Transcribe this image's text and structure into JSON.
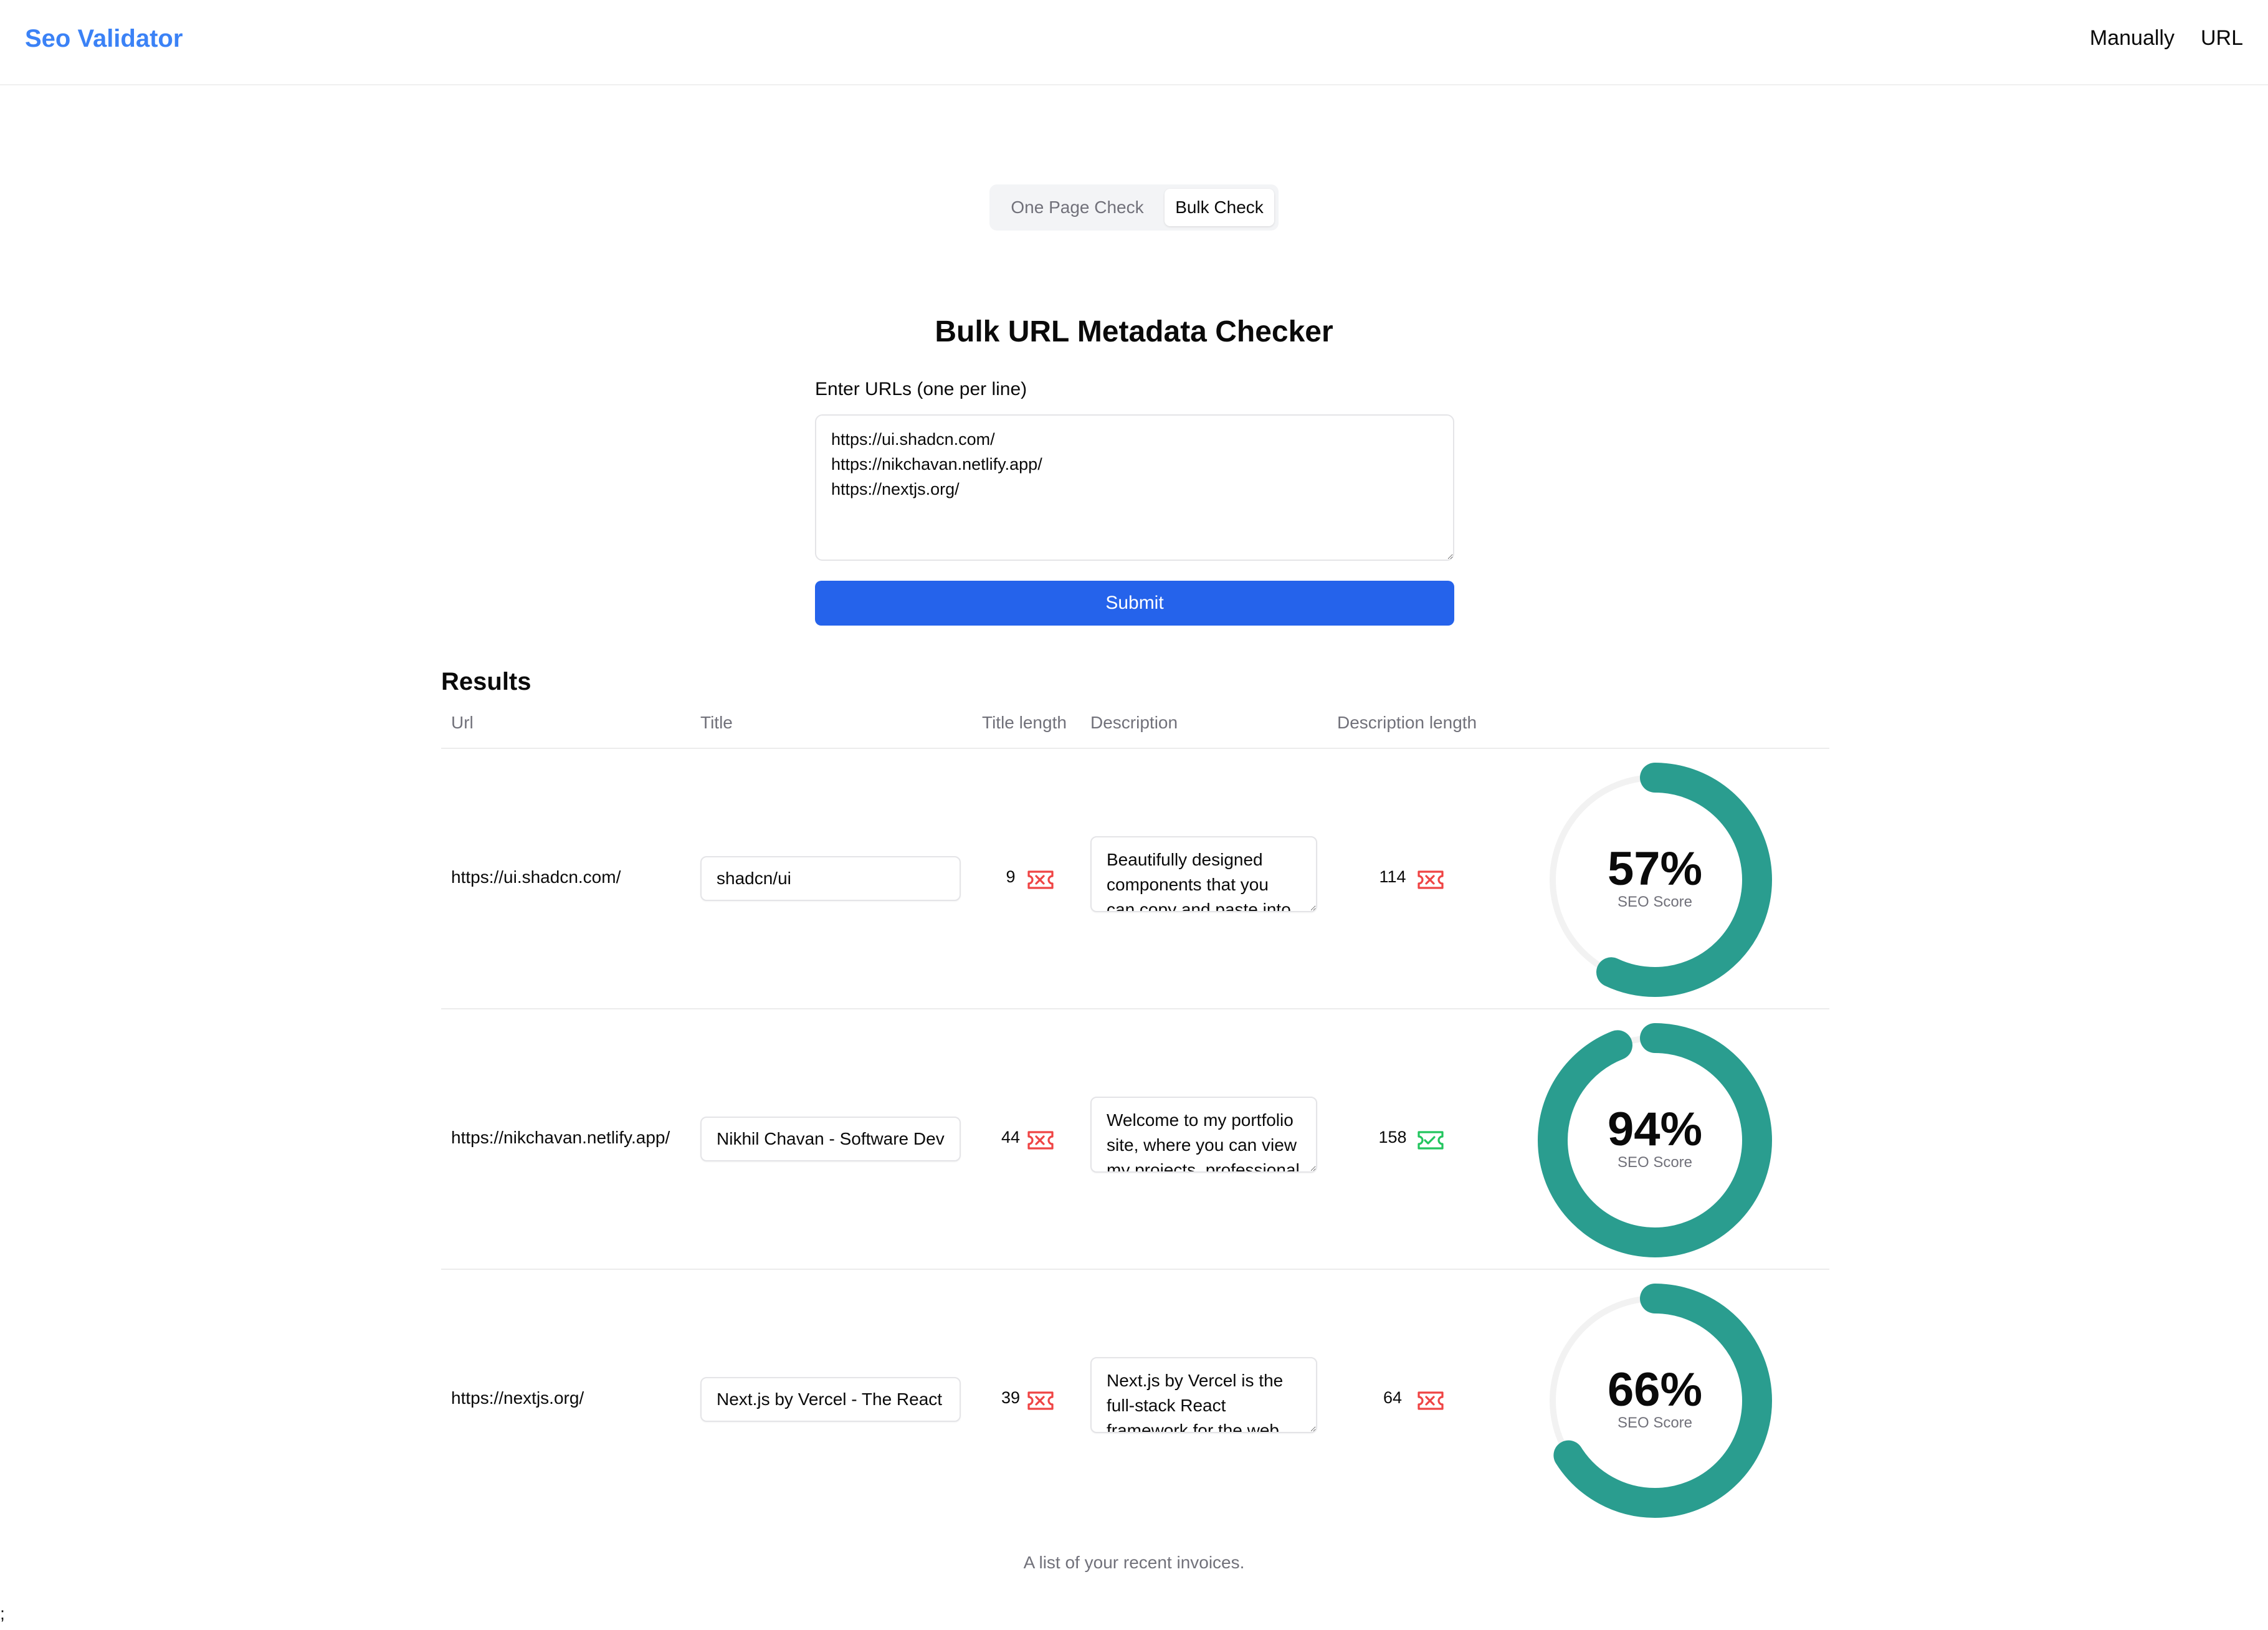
{
  "header": {
    "brand": "Seo Validator",
    "nav": [
      "Manually",
      "URL"
    ],
    "brand_color": "#3b82f6"
  },
  "tabs": {
    "items": [
      "One Page Check",
      "Bulk Check"
    ],
    "active": "Bulk Check"
  },
  "form": {
    "heading": "Bulk URL Metadata Checker",
    "label": "Enter URLs (one per line)",
    "urls_value": "https://ui.shadcn.com/\nhttps://nikchavan.netlify.app/\nhttps://nextjs.org/",
    "submit_label": "Submit",
    "submit_color": "#2563eb"
  },
  "results": {
    "title": "Results",
    "columns": [
      "Url",
      "Title",
      "Title length",
      "Description",
      "Description length"
    ],
    "rows": [
      {
        "url": "https://ui.shadcn.com/",
        "title": "shadcn/ui",
        "title_length": "9",
        "title_length_ok": false,
        "description": "Beautifully designed components that you can copy and paste into your apps. Accessible. Customizable. Open Source.",
        "description_length": "114",
        "description_length_ok": false,
        "score": 57,
        "score_text": "57%",
        "score_label": "SEO Score"
      },
      {
        "url": "https://nikchavan.netlify.app/",
        "title": "Nikhil Chavan - Software Developer",
        "title_length": "44",
        "title_length_ok": false,
        "description": "Welcome to my portfolio site, where you can view my projects, professional experience, and skills as a software developer.",
        "description_length": "158",
        "description_length_ok": true,
        "score": 94,
        "score_text": "94%",
        "score_label": "SEO Score"
      },
      {
        "url": "https://nextjs.org/",
        "title": "Next.js by Vercel - The React Framework",
        "title_length": "39",
        "title_length_ok": false,
        "description": "Next.js by Vercel is the full-stack React framework for the web.",
        "description_length": "64",
        "description_length_ok": false,
        "score": 66,
        "score_text": "66%",
        "score_label": "SEO Score"
      }
    ],
    "caption": "A list of your recent invoices.",
    "gauge_color": "#2a9d8f",
    "gauge_track_color": "#f2f2f2",
    "ok_color": "#22c55e",
    "bad_color": "#ef4444",
    "ok_icon": "ticket-check-icon",
    "bad_icon": "ticket-x-icon"
  },
  "stray_text": ";"
}
